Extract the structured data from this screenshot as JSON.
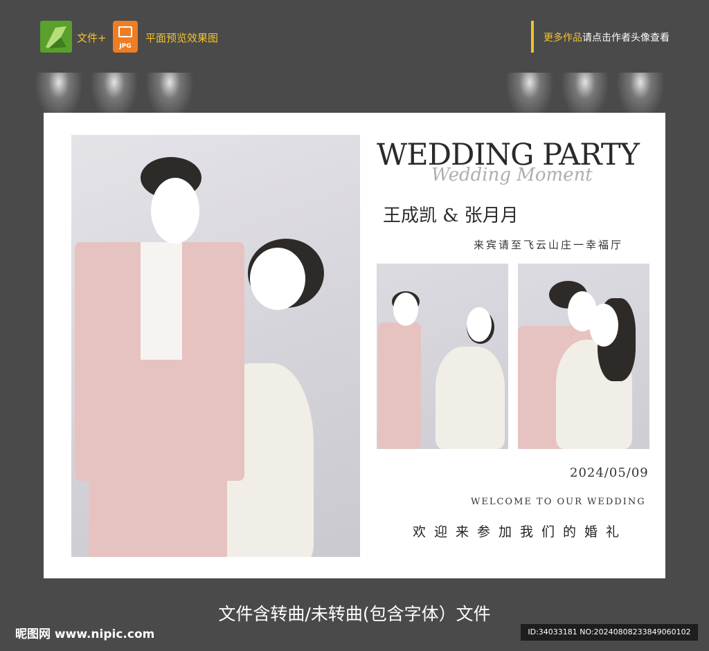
{
  "topbar": {
    "file_label": "文件+",
    "jpg_label": "JPG",
    "preview_label": "平面预览效果图",
    "more_highlight": "更多作品",
    "more_rest": "请点击作者头像查看"
  },
  "card": {
    "title": "WEDDING PARTY",
    "script": "Wedding Moment",
    "names": "王成凯 & 张月月",
    "venue": "来宾请至飞云山庄一幸福厅",
    "date": "2024/05/09",
    "welcome_en": "WELCOME TO OUR WEDDING",
    "welcome_cn": "欢迎来参加我们的婚礼"
  },
  "footer": {
    "caption": "文件含转曲/未转曲(包含字体）文件",
    "brand": "昵图网 www.nipic.com",
    "id_text": "ID:34033181 NO:20240808233849060102"
  },
  "colors": {
    "background": "#4a4a4a",
    "accent": "#f2c230",
    "suit": "#e6c3c0"
  }
}
